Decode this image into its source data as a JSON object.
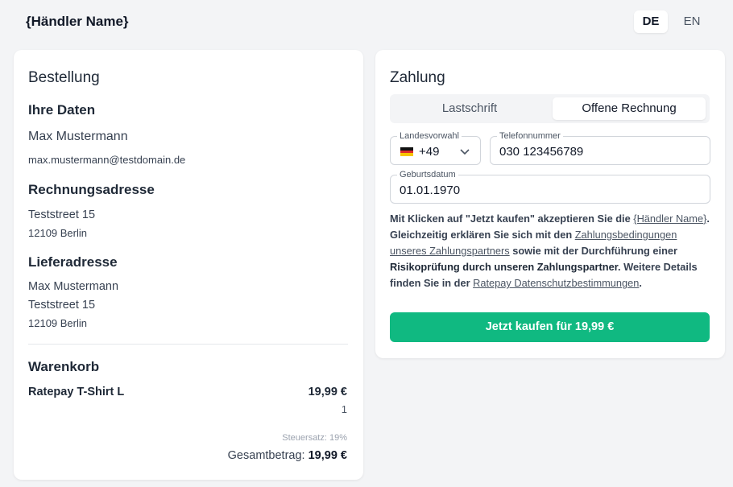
{
  "header": {
    "merchant_name": "{Händler Name}",
    "languages": [
      "DE",
      "EN"
    ],
    "active_language": "DE"
  },
  "order": {
    "title": "Bestellung",
    "your_data": {
      "heading": "Ihre Daten",
      "name": "Max Mustermann",
      "email": "max.mustermann@testdomain.de"
    },
    "billing": {
      "heading": "Rechnungsadresse",
      "street": "Teststreet 15",
      "city": "12109 Berlin"
    },
    "shipping": {
      "heading": "Lieferadresse",
      "name": "Max Mustermann",
      "street": "Teststreet 15",
      "city": "12109 Berlin"
    },
    "cart": {
      "heading": "Warenkorb",
      "items": [
        {
          "name": "Ratepay T-Shirt L",
          "price": "19,99 €",
          "quantity": "1"
        }
      ],
      "tax_label": "Steuersatz: 19%",
      "total_label": "Gesamtbetrag:",
      "total_value": "19,99 €"
    }
  },
  "payment": {
    "title": "Zahlung",
    "tabs": [
      {
        "label": "Lastschrift",
        "active": false
      },
      {
        "label": "Offene Rechnung",
        "active": true
      }
    ],
    "country_code": {
      "label": "Landesvorwahl",
      "value": "+49",
      "flag": "de-flag-icon"
    },
    "phone": {
      "label": "Telefonnummer",
      "value": "030 123456789"
    },
    "birthdate": {
      "label": "Geburtsdatum",
      "value": "01.01.1970"
    },
    "consent": {
      "p1": "Mit Klicken auf \"Jetzt kaufen\" akzeptieren Sie die ",
      "link_merchant": "{Händler Name}",
      "p2": ". Gleichzeitig erklären Sie sich mit den ",
      "link_terms": "Zahlungsbedingungen unseres Zahlungspartners",
      "p3": " sowie mit der Durchführung einer ",
      "bold": "Risikoprüfung durch unseren Zahlungspartner",
      "p4": ". Weitere Details finden Sie in der ",
      "link_privacy": "Ratepay Datenschutzbestimmungen",
      "p5": "."
    },
    "buy_button": "Jetzt kaufen für 19,99 €"
  },
  "colors": {
    "accent": "#10b981",
    "background": "#f3f4f6",
    "text": "#1f2937"
  }
}
